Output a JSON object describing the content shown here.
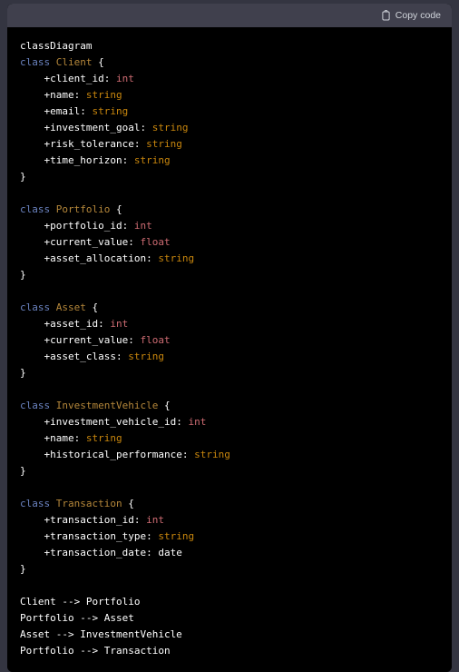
{
  "window": {
    "background_color": "#343541"
  },
  "code_block": {
    "header": {
      "copy_label": "Copy code",
      "copy_icon": "clipboard-icon",
      "background_color": "#40404d",
      "text_color": "#d1d5db"
    },
    "language": "mermaid",
    "background_color": "#000000",
    "syntax_colors": {
      "keyword": "#6a82bf",
      "class_name": "#b5873a",
      "type_numeric": "#cd6b72",
      "type_string": "#c8860d",
      "plain": "#ffffff"
    },
    "lines": [
      {
        "indent": 0,
        "tokens": [
          {
            "t": "classDiagram",
            "c": "plain"
          }
        ]
      },
      {
        "indent": 0,
        "tokens": [
          {
            "t": "class ",
            "c": "keyword"
          },
          {
            "t": "Client",
            "c": "classname"
          },
          {
            "t": " {",
            "c": "punct"
          }
        ]
      },
      {
        "indent": 1,
        "tokens": [
          {
            "t": "+client_id: ",
            "c": "member"
          },
          {
            "t": "int",
            "c": "type-num"
          }
        ]
      },
      {
        "indent": 1,
        "tokens": [
          {
            "t": "+name: ",
            "c": "member"
          },
          {
            "t": "string",
            "c": "type-str"
          }
        ]
      },
      {
        "indent": 1,
        "tokens": [
          {
            "t": "+email: ",
            "c": "member"
          },
          {
            "t": "string",
            "c": "type-str"
          }
        ]
      },
      {
        "indent": 1,
        "tokens": [
          {
            "t": "+investment_goal: ",
            "c": "member"
          },
          {
            "t": "string",
            "c": "type-str"
          }
        ]
      },
      {
        "indent": 1,
        "tokens": [
          {
            "t": "+risk_tolerance: ",
            "c": "member"
          },
          {
            "t": "string",
            "c": "type-str"
          }
        ]
      },
      {
        "indent": 1,
        "tokens": [
          {
            "t": "+time_horizon: ",
            "c": "member"
          },
          {
            "t": "string",
            "c": "type-str"
          }
        ]
      },
      {
        "indent": 0,
        "tokens": [
          {
            "t": "}",
            "c": "punct"
          }
        ]
      },
      {
        "indent": 0,
        "tokens": []
      },
      {
        "indent": 0,
        "tokens": [
          {
            "t": "class ",
            "c": "keyword"
          },
          {
            "t": "Portfolio",
            "c": "classname"
          },
          {
            "t": " {",
            "c": "punct"
          }
        ]
      },
      {
        "indent": 1,
        "tokens": [
          {
            "t": "+portfolio_id: ",
            "c": "member"
          },
          {
            "t": "int",
            "c": "type-num"
          }
        ]
      },
      {
        "indent": 1,
        "tokens": [
          {
            "t": "+current_value: ",
            "c": "member"
          },
          {
            "t": "float",
            "c": "type-num"
          }
        ]
      },
      {
        "indent": 1,
        "tokens": [
          {
            "t": "+asset_allocation: ",
            "c": "member"
          },
          {
            "t": "string",
            "c": "type-str"
          }
        ]
      },
      {
        "indent": 0,
        "tokens": [
          {
            "t": "}",
            "c": "punct"
          }
        ]
      },
      {
        "indent": 0,
        "tokens": []
      },
      {
        "indent": 0,
        "tokens": [
          {
            "t": "class ",
            "c": "keyword"
          },
          {
            "t": "Asset",
            "c": "classname"
          },
          {
            "t": " {",
            "c": "punct"
          }
        ]
      },
      {
        "indent": 1,
        "tokens": [
          {
            "t": "+asset_id: ",
            "c": "member"
          },
          {
            "t": "int",
            "c": "type-num"
          }
        ]
      },
      {
        "indent": 1,
        "tokens": [
          {
            "t": "+current_value: ",
            "c": "member"
          },
          {
            "t": "float",
            "c": "type-num"
          }
        ]
      },
      {
        "indent": 1,
        "tokens": [
          {
            "t": "+asset_class: ",
            "c": "member"
          },
          {
            "t": "string",
            "c": "type-str"
          }
        ]
      },
      {
        "indent": 0,
        "tokens": [
          {
            "t": "}",
            "c": "punct"
          }
        ]
      },
      {
        "indent": 0,
        "tokens": []
      },
      {
        "indent": 0,
        "tokens": [
          {
            "t": "class ",
            "c": "keyword"
          },
          {
            "t": "InvestmentVehicle",
            "c": "classname"
          },
          {
            "t": " {",
            "c": "punct"
          }
        ]
      },
      {
        "indent": 1,
        "tokens": [
          {
            "t": "+investment_vehicle_id: ",
            "c": "member"
          },
          {
            "t": "int",
            "c": "type-num"
          }
        ]
      },
      {
        "indent": 1,
        "tokens": [
          {
            "t": "+name: ",
            "c": "member"
          },
          {
            "t": "string",
            "c": "type-str"
          }
        ]
      },
      {
        "indent": 1,
        "tokens": [
          {
            "t": "+historical_performance: ",
            "c": "member"
          },
          {
            "t": "string",
            "c": "type-str"
          }
        ]
      },
      {
        "indent": 0,
        "tokens": [
          {
            "t": "}",
            "c": "punct"
          }
        ]
      },
      {
        "indent": 0,
        "tokens": []
      },
      {
        "indent": 0,
        "tokens": [
          {
            "t": "class ",
            "c": "keyword"
          },
          {
            "t": "Transaction",
            "c": "classname"
          },
          {
            "t": " {",
            "c": "punct"
          }
        ]
      },
      {
        "indent": 1,
        "tokens": [
          {
            "t": "+transaction_id: ",
            "c": "member"
          },
          {
            "t": "int",
            "c": "type-num"
          }
        ]
      },
      {
        "indent": 1,
        "tokens": [
          {
            "t": "+transaction_type: ",
            "c": "member"
          },
          {
            "t": "string",
            "c": "type-str"
          }
        ]
      },
      {
        "indent": 1,
        "tokens": [
          {
            "t": "+transaction_date: date",
            "c": "member"
          }
        ]
      },
      {
        "indent": 0,
        "tokens": [
          {
            "t": "}",
            "c": "punct"
          }
        ]
      },
      {
        "indent": 0,
        "tokens": []
      },
      {
        "indent": 0,
        "tokens": [
          {
            "t": "Client --> Portfolio",
            "c": "rel"
          }
        ]
      },
      {
        "indent": 0,
        "tokens": [
          {
            "t": "Portfolio --> Asset",
            "c": "rel"
          }
        ]
      },
      {
        "indent": 0,
        "tokens": [
          {
            "t": "Asset --> InvestmentVehicle",
            "c": "rel"
          }
        ]
      },
      {
        "indent": 0,
        "tokens": [
          {
            "t": "Portfolio --> Transaction",
            "c": "rel"
          }
        ]
      }
    ],
    "diagram_summary": {
      "type": "classDiagram",
      "classes": [
        {
          "name": "Client",
          "attributes": [
            {
              "visibility": "+",
              "name": "client_id",
              "type": "int"
            },
            {
              "visibility": "+",
              "name": "name",
              "type": "string"
            },
            {
              "visibility": "+",
              "name": "email",
              "type": "string"
            },
            {
              "visibility": "+",
              "name": "investment_goal",
              "type": "string"
            },
            {
              "visibility": "+",
              "name": "risk_tolerance",
              "type": "string"
            },
            {
              "visibility": "+",
              "name": "time_horizon",
              "type": "string"
            }
          ]
        },
        {
          "name": "Portfolio",
          "attributes": [
            {
              "visibility": "+",
              "name": "portfolio_id",
              "type": "int"
            },
            {
              "visibility": "+",
              "name": "current_value",
              "type": "float"
            },
            {
              "visibility": "+",
              "name": "asset_allocation",
              "type": "string"
            }
          ]
        },
        {
          "name": "Asset",
          "attributes": [
            {
              "visibility": "+",
              "name": "asset_id",
              "type": "int"
            },
            {
              "visibility": "+",
              "name": "current_value",
              "type": "float"
            },
            {
              "visibility": "+",
              "name": "asset_class",
              "type": "string"
            }
          ]
        },
        {
          "name": "InvestmentVehicle",
          "attributes": [
            {
              "visibility": "+",
              "name": "investment_vehicle_id",
              "type": "int"
            },
            {
              "visibility": "+",
              "name": "name",
              "type": "string"
            },
            {
              "visibility": "+",
              "name": "historical_performance",
              "type": "string"
            }
          ]
        },
        {
          "name": "Transaction",
          "attributes": [
            {
              "visibility": "+",
              "name": "transaction_id",
              "type": "int"
            },
            {
              "visibility": "+",
              "name": "transaction_type",
              "type": "string"
            },
            {
              "visibility": "+",
              "name": "transaction_date",
              "type": "date"
            }
          ]
        }
      ],
      "relationships": [
        {
          "from": "Client",
          "arrow": "-->",
          "to": "Portfolio"
        },
        {
          "from": "Portfolio",
          "arrow": "-->",
          "to": "Asset"
        },
        {
          "from": "Asset",
          "arrow": "-->",
          "to": "InvestmentVehicle"
        },
        {
          "from": "Portfolio",
          "arrow": "-->",
          "to": "Transaction"
        }
      ]
    }
  }
}
